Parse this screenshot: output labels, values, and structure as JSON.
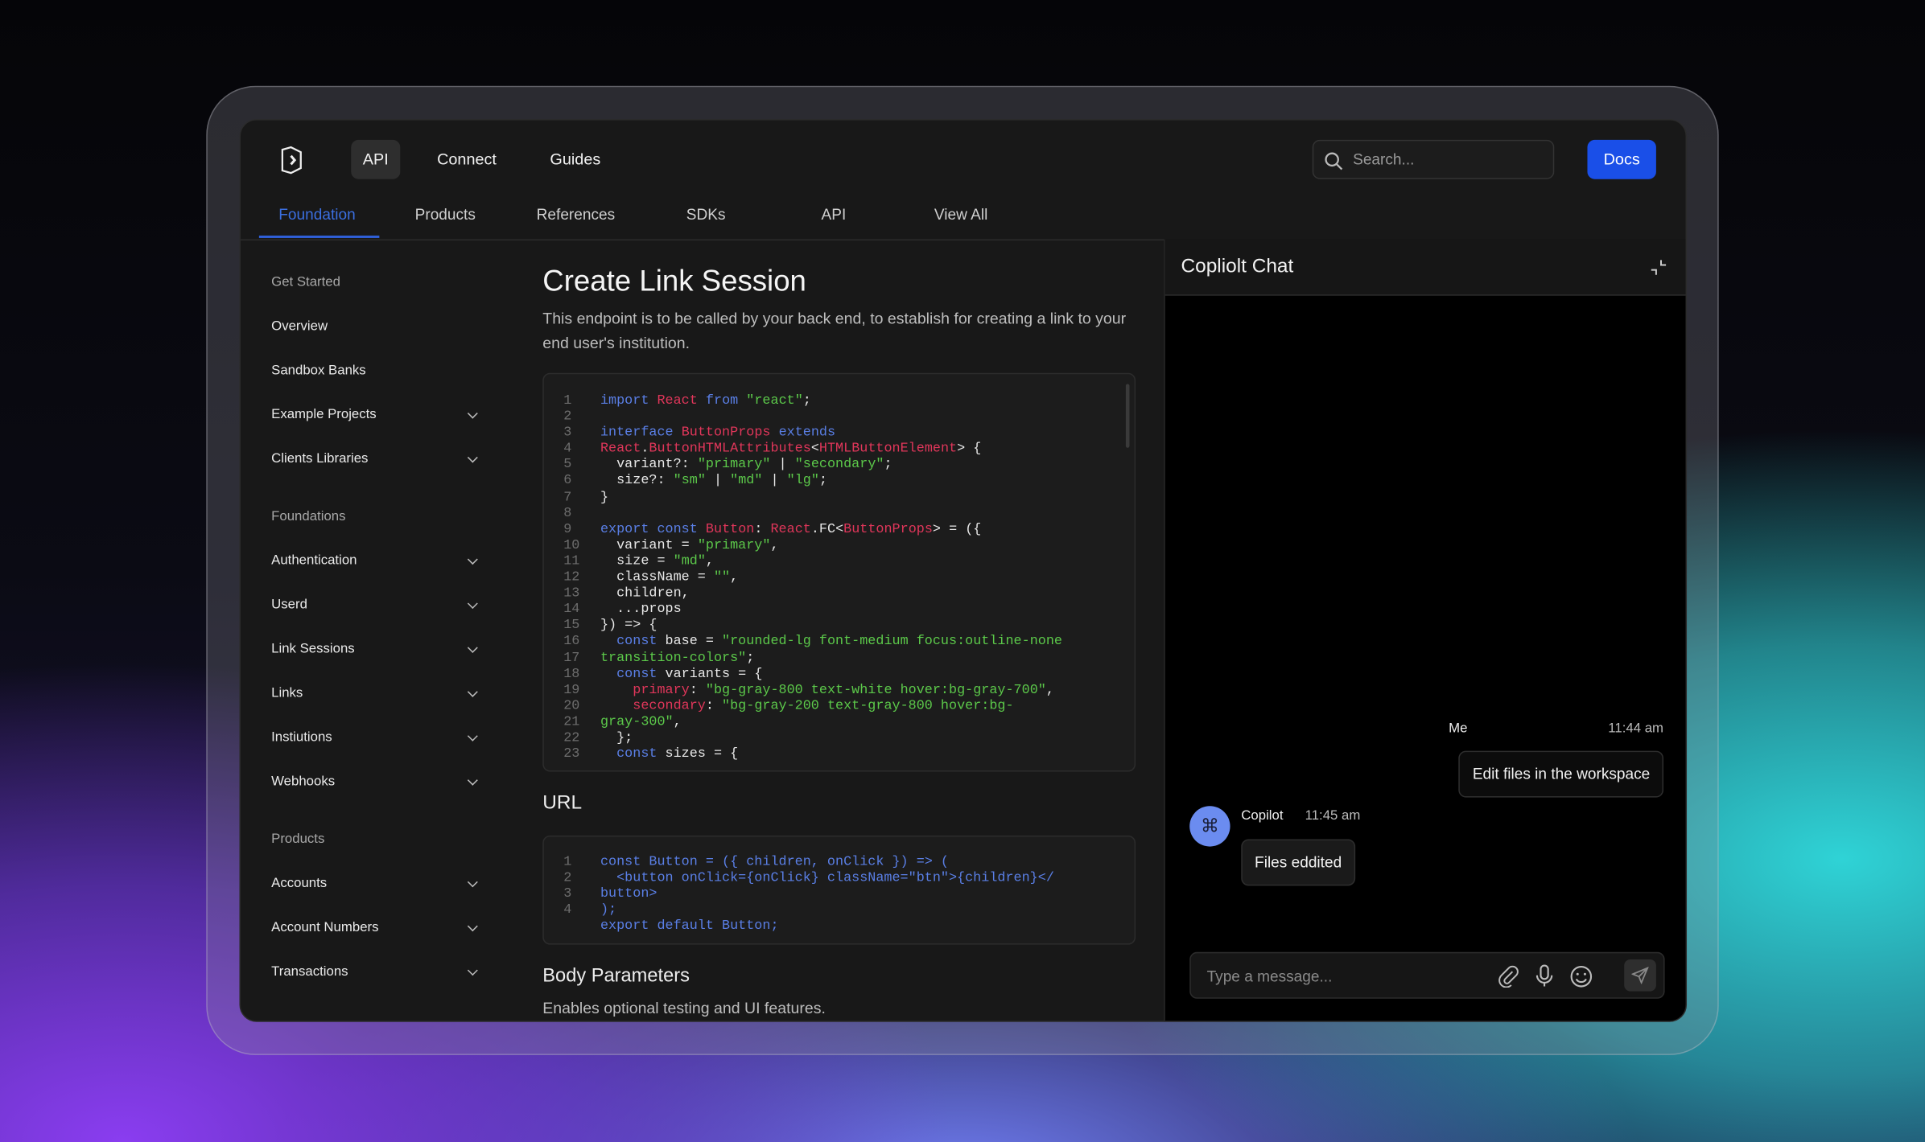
{
  "header": {
    "nav": [
      "API",
      "Connect",
      "Guides"
    ],
    "search_placeholder": "Search...",
    "docs_label": "Docs"
  },
  "tabs": [
    "Foundation",
    "Products",
    "References",
    "SDKs",
    "API",
    "View All"
  ],
  "sidebar": {
    "sections": [
      {
        "title": "Get Started",
        "items": [
          {
            "label": "Overview",
            "expandable": false
          },
          {
            "label": "Sandbox Banks",
            "expandable": false
          },
          {
            "label": "Example Projects",
            "expandable": true
          },
          {
            "label": "Clients Libraries",
            "expandable": true
          }
        ]
      },
      {
        "title": "Foundations",
        "items": [
          {
            "label": "Authentication",
            "expandable": true
          },
          {
            "label": "Userd",
            "expandable": true
          },
          {
            "label": "Link Sessions",
            "expandable": true
          },
          {
            "label": "Links",
            "expandable": true
          },
          {
            "label": "Instiutions",
            "expandable": true
          },
          {
            "label": "Webhooks",
            "expandable": true
          }
        ]
      },
      {
        "title": "Products",
        "items": [
          {
            "label": "Accounts",
            "expandable": true
          },
          {
            "label": "Account Numbers",
            "expandable": true
          },
          {
            "label": "Transactions",
            "expandable": true
          }
        ]
      }
    ]
  },
  "main": {
    "title": "Create Link Session",
    "description": "This endpoint is to be called by your back end, to establish for creating a link to your end user's institution.",
    "code1": {
      "line_numbers": [
        "1",
        "2",
        "3",
        "4",
        "5",
        "6",
        "7",
        "8",
        "9",
        "10",
        "11",
        "12",
        "13",
        "14",
        "15",
        "16",
        "17",
        "18",
        "19",
        "20",
        "21",
        "22",
        "23"
      ],
      "lines": [
        "<k>import</k> <r>React</r> <k>from</k> <g>\"react\"</g>;",
        "",
        "<k>interface</k> <r>ButtonProps</r> <k>extends</k>",
        "<r>React</r>.<r>ButtonHTMLAttributes</r>&lt;<r>HTMLButtonElement</r>&gt; {",
        "  variant?: <g>\"primary\"</g> | <g>\"secondary\"</g>;",
        "  size?: <g>\"sm\"</g> | <g>\"md\"</g> | <g>\"lg\"</g>;",
        "}",
        "",
        "<k>export</k> <k>const</k> <r>Button</r>: <r>React</r>.FC&lt;<r>ButtonProps</r>&gt; = ({",
        "  variant = <g>\"primary\"</g>,",
        "  size = <g>\"md\"</g>,",
        "  className = <g>\"\"</g>,",
        "  children,",
        "  ...props",
        "}) =&gt; {",
        "  <k>const</k> base = <g>\"rounded-lg font-medium focus:outline-none</g>",
        "<g>transition-colors\"</g>;",
        "  <k>const</k> variants = {",
        "    <r>primary</r>: <g>\"bg-gray-800 text-white hover:bg-gray-700\"</g>,",
        "    <r>secondary</r>: <g>\"bg-gray-200 text-gray-800 hover:bg-</g>",
        "<g>gray-300\"</g>,",
        "  };",
        "  <k>const</k> sizes = {"
      ]
    },
    "url_heading": "URL",
    "code2": {
      "line_numbers": [
        "1",
        "2",
        "3",
        "4"
      ],
      "lines": [
        "const Button = ({ children, onClick }) => (",
        "  <button onClick={onClick} className=\"btn\">{children}</",
        "button>",
        ");",
        "export default Button;"
      ]
    },
    "body_heading": "Body Parameters",
    "body_description": "Enables optional testing and UI features."
  },
  "chat": {
    "title": "Copliolt Chat",
    "messages": [
      {
        "sender": "Me",
        "time": "11:44 am",
        "text": "Edit files in the workspace"
      },
      {
        "sender": "Copilot",
        "time": "11:45 am",
        "text": "Files eddited"
      }
    ],
    "input_placeholder": "Type a message..."
  },
  "colors": {
    "accent": "#1a4fe8",
    "tab_active": "#3b6fe0",
    "avatar": "#6b8cf0"
  }
}
